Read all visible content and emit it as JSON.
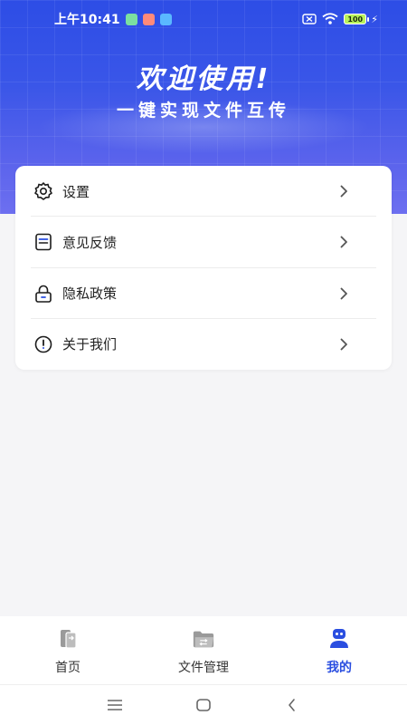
{
  "status_bar": {
    "time": "上午10:41",
    "battery": "100",
    "app_badges": [
      "#7be0a0",
      "#ff8a7a",
      "#5ab8ff"
    ]
  },
  "hero": {
    "title": "欢迎使用!",
    "subtitle": "一键实现文件互传"
  },
  "menu": {
    "items": [
      {
        "label": "设置",
        "icon": "gear-icon"
      },
      {
        "label": "意见反馈",
        "icon": "feedback-icon"
      },
      {
        "label": "隐私政策",
        "icon": "lock-icon"
      },
      {
        "label": "关于我们",
        "icon": "info-icon"
      }
    ]
  },
  "bottom_nav": {
    "items": [
      {
        "label": "首页",
        "icon": "phone-transfer-icon",
        "active": false
      },
      {
        "label": "文件管理",
        "icon": "folder-icon",
        "active": false
      },
      {
        "label": "我的",
        "icon": "robot-icon",
        "active": true
      }
    ]
  },
  "colors": {
    "accent": "#2a4ee0",
    "banner_top": "#2d4de6",
    "banner_bottom": "#6d6ff0"
  }
}
